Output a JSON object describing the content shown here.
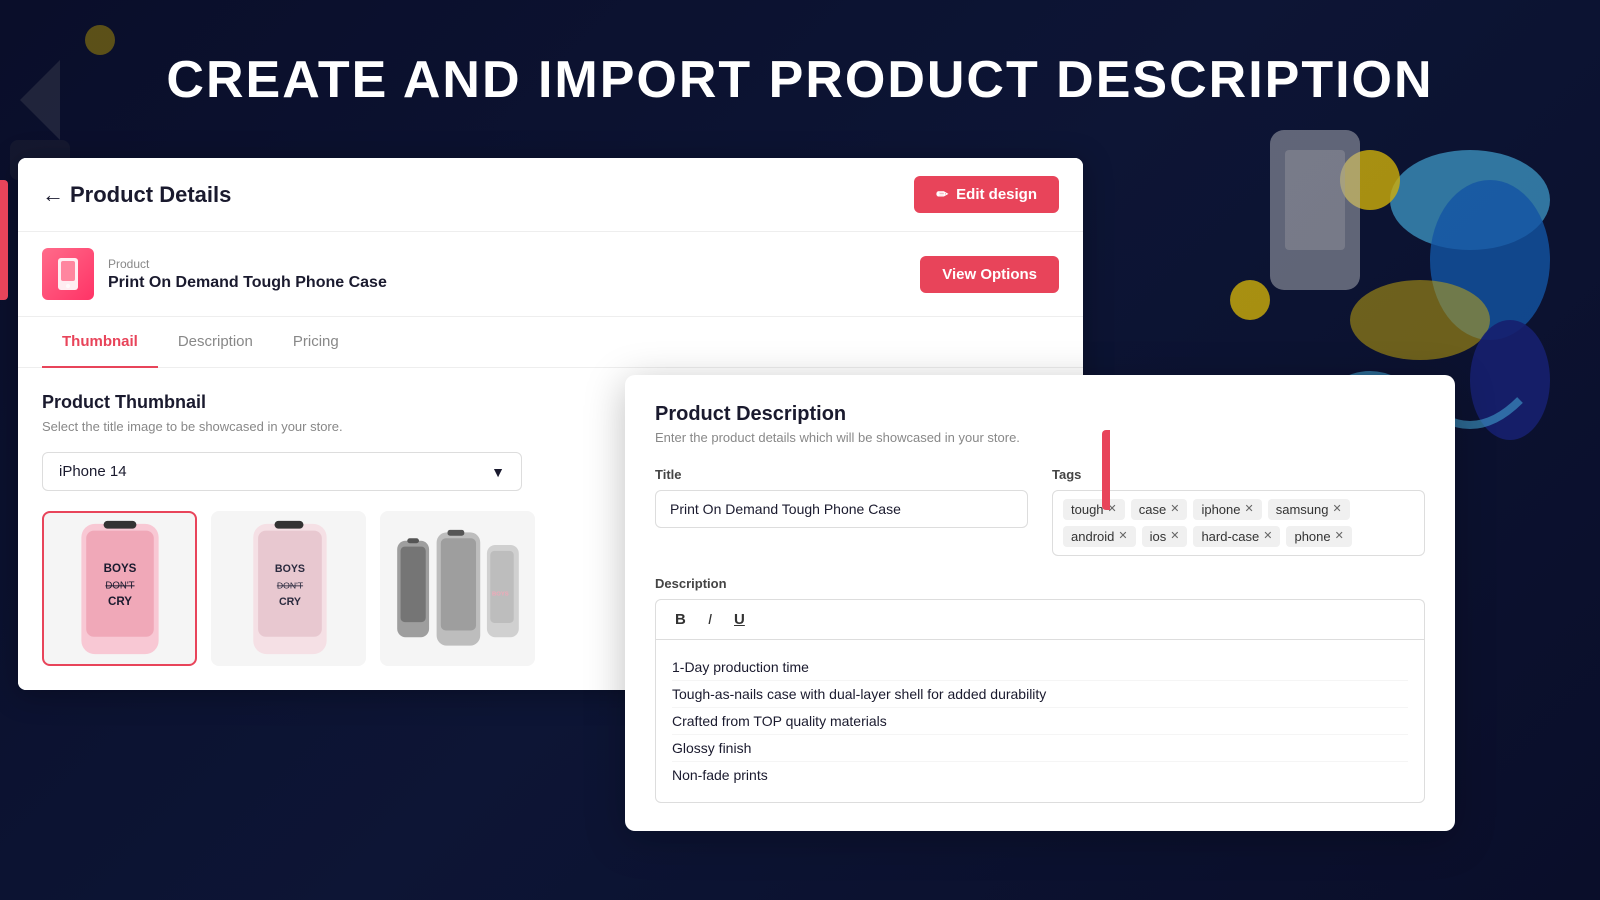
{
  "page": {
    "title": "CREATE AND IMPORT PRODUCT DESCRIPTION",
    "background_color": "#0a0e2a"
  },
  "product_details": {
    "header": {
      "back_label": "Product Details",
      "edit_design_label": "Edit design"
    },
    "product_info": {
      "label": "Product",
      "name": "Print On Demand Tough Phone Case",
      "view_options_label": "View Options"
    },
    "tabs": [
      {
        "id": "thumbnail",
        "label": "Thumbnail",
        "active": true
      },
      {
        "id": "description",
        "label": "Description",
        "active": false
      },
      {
        "id": "pricing",
        "label": "Pricing",
        "active": false
      }
    ],
    "thumbnail_section": {
      "title": "Product Thumbnail",
      "subtitle": "Select the title image to be showcased in your store.",
      "dropdown_value": "iPhone 14",
      "thumbnails": [
        {
          "id": 1,
          "alt": "Pink phone case front view",
          "selected": true
        },
        {
          "id": 2,
          "alt": "Pink phone case front view 2",
          "selected": false
        },
        {
          "id": 3,
          "alt": "Gray phone case multiple views",
          "selected": false
        }
      ]
    }
  },
  "product_description": {
    "title": "Product Description",
    "subtitle": "Enter the product details which will be showcased in your store.",
    "title_label": "Title",
    "title_value": "Print On Demand Tough Phone Case",
    "tags_label": "Tags",
    "tags": [
      {
        "label": "tough",
        "removable": true
      },
      {
        "label": "case",
        "removable": true
      },
      {
        "label": "iphone",
        "removable": true
      },
      {
        "label": "samsung",
        "removable": true
      },
      {
        "label": "android",
        "removable": true
      },
      {
        "label": "ios",
        "removable": true
      },
      {
        "label": "hard-case",
        "removable": true
      },
      {
        "label": "phone",
        "removable": true
      }
    ],
    "description_label": "Description",
    "toolbar": {
      "bold": "B",
      "italic": "I",
      "underline": "U"
    },
    "description_items": [
      "1-Day production time",
      "Tough-as-nails case with dual-layer shell for added durability",
      "Crafted from TOP quality materials",
      "Glossy finish",
      "Non-fade prints"
    ]
  }
}
